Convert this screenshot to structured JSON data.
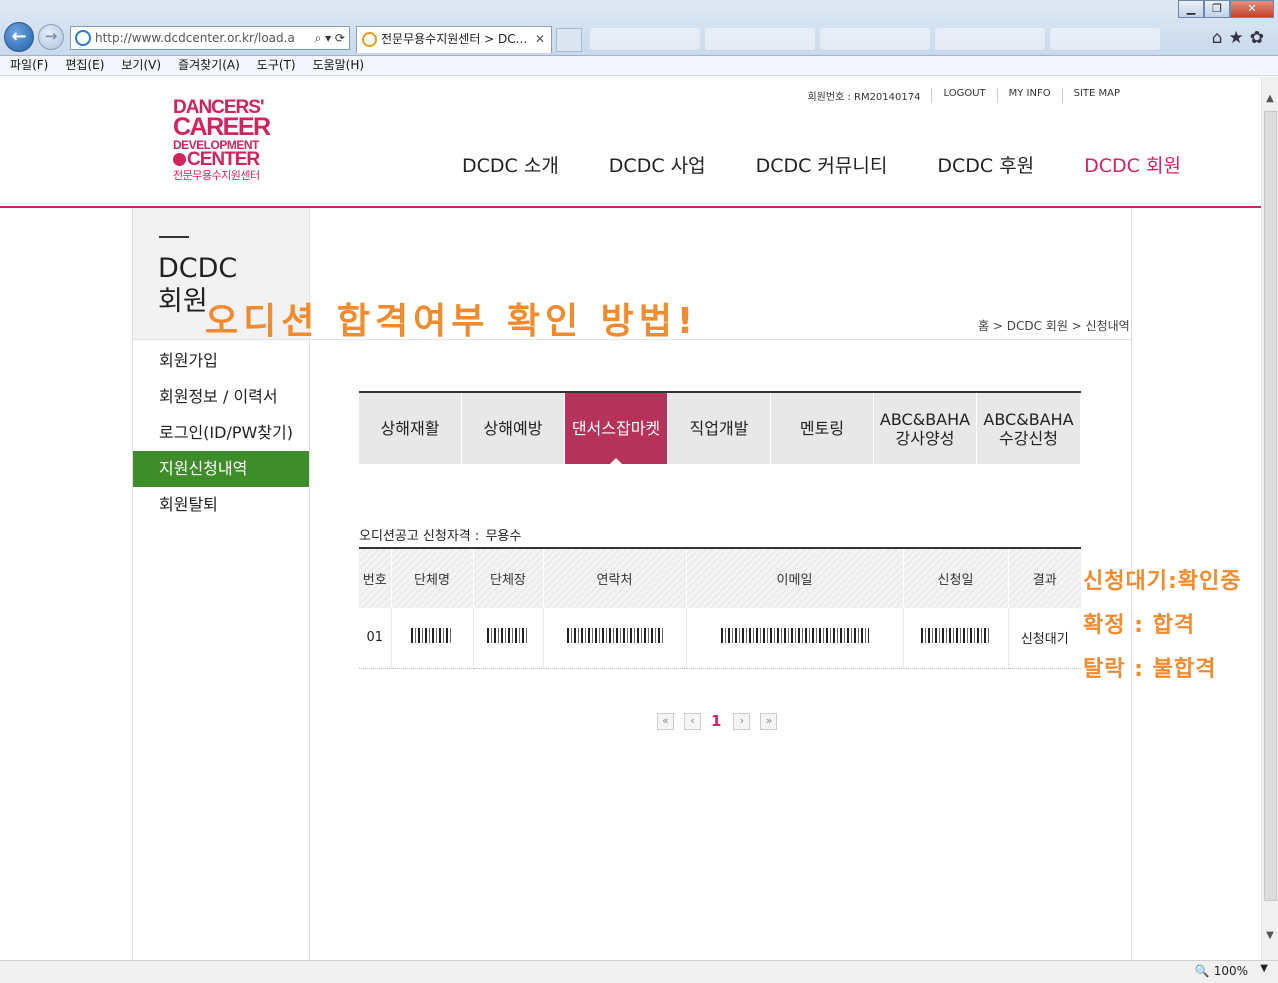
{
  "browser": {
    "address": "http://www.dcdcenter.or.kr/load.a",
    "tab_title": "전문무용수지원센터 > DC...",
    "tab_close": "✕",
    "menu": [
      "파일(F)",
      "편집(E)",
      "보기(V)",
      "즐겨찾기(A)",
      "도구(T)",
      "도움말(H)"
    ],
    "zoom": "100%",
    "back_icon": "←",
    "forward_icon": "→",
    "window_buttons": [
      "▁",
      "❐",
      "✕"
    ],
    "tool_icons": "⌂★✿"
  },
  "logo": {
    "line1": "DANCERS'",
    "line2": "CAREER",
    "line3": "DEVELOPMENT",
    "line4": "CENTER",
    "line5": "전문무용수지원센터"
  },
  "utility": {
    "member_no": "회원번호 : RM20140174",
    "logout": "LOGOUT",
    "my_info": "MY INFO",
    "site_map": "SITE MAP"
  },
  "gnb": [
    "DCDC 소개",
    "DCDC 사업",
    "DCDC 커뮤니티",
    "DCDC 후원",
    "DCDC 회원"
  ],
  "sidebar": {
    "title_line1": "DCDC",
    "title_line2": "회원",
    "items": [
      "회원가입",
      "회원정보 / 이력서",
      "로그인(ID/PW찾기)",
      "지원신청내역",
      "회원탈퇴"
    ],
    "active": "지원신청내역"
  },
  "headline": "오디션 합격여부 확인 방법!",
  "breadcrumb": "홈 > DCDC 회원 > 신청내역",
  "tabs": [
    "상해재활",
    "상해예방",
    "댄서스잡마켓",
    "직업개발",
    "멘토링",
    "ABC&BAHA\n강사양성",
    "ABC&BAHA\n수강신청"
  ],
  "active_tab": "댄서스잡마켓",
  "qualification": {
    "label": "오디션공고 신청자격 :",
    "value": "무용수"
  },
  "table": {
    "headers": [
      "번호",
      "단체명",
      "단체장",
      "연락처",
      "이메일",
      "신청일",
      "결과"
    ],
    "rows": [
      {
        "no": "01",
        "result": "신청대기"
      }
    ]
  },
  "pagination": {
    "first": "«",
    "prev": "‹",
    "current": "1",
    "next": "›",
    "last": "»"
  },
  "legend": [
    "신청대기:확인중",
    "확정 : 합격",
    "탈락 : 불합격"
  ],
  "colors": {
    "brand": "#d0245c",
    "active_tab": "#b5325b",
    "active_side": "#3e8c2a",
    "annotation": "#f28a2e"
  }
}
